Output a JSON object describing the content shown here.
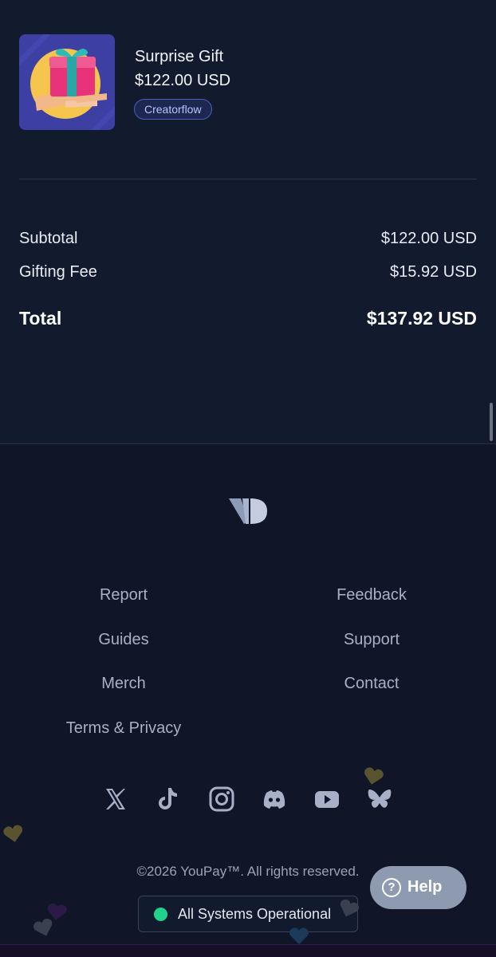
{
  "order": {
    "item": {
      "name": "Surprise Gift",
      "price": "$122.00 USD",
      "badge": "Creatorflow",
      "image_icon": "gift-in-hand-icon"
    },
    "summary": {
      "subtotal_label": "Subtotal",
      "subtotal_value": "$122.00 USD",
      "fee_label": "Gifting Fee",
      "fee_value": "$15.92 USD",
      "total_label": "Total",
      "total_value": "$137.92 USD"
    }
  },
  "footer": {
    "logo_icon": "youpay-logo-icon",
    "links_left": [
      "Report",
      "Guides",
      "Merch",
      "Terms & Privacy"
    ],
    "links_right": [
      "Feedback",
      "Support",
      "Contact"
    ],
    "social_icons": [
      "x-icon",
      "tiktok-icon",
      "instagram-icon",
      "discord-icon",
      "youtube-icon",
      "bluesky-icon"
    ],
    "copyright": "©2026 YouPay™. All rights reserved.",
    "status": "All Systems Operational"
  },
  "help": {
    "label": "Help",
    "icon": "question-circle-icon"
  },
  "colors": {
    "background": "#121a2e",
    "footer_background": "#101627",
    "accent_badge": "#b8c6ff",
    "status_ok": "#21d38a"
  }
}
